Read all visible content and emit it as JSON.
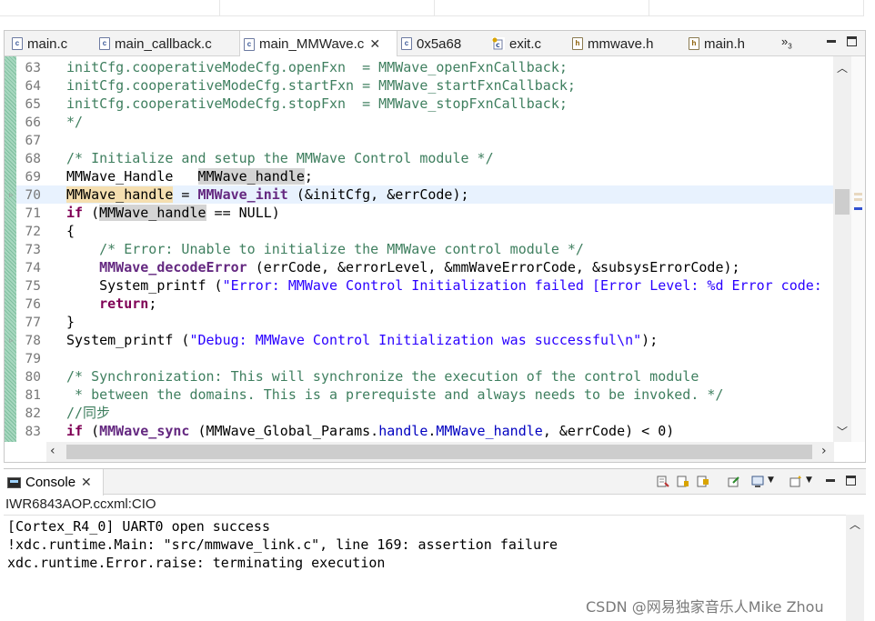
{
  "tabs": [
    {
      "label": "main.c",
      "icon": "c-file-icon",
      "active": false
    },
    {
      "label": "main_callback.c",
      "icon": "c-file-icon",
      "active": false
    },
    {
      "label": "main_MMWave.c",
      "icon": "c-file-icon",
      "active": true
    },
    {
      "label": "0x5a68",
      "icon": "disassembly-icon",
      "active": false
    },
    {
      "label": "exit.c",
      "icon": "c-file-icon",
      "active": false
    },
    {
      "label": "mmwave.h",
      "icon": "h-file-icon",
      "active": false
    },
    {
      "label": "main.h",
      "icon": "h-file-icon",
      "active": false
    }
  ],
  "tab_overflow": {
    "glyph": "»",
    "count": "3"
  },
  "code_lines": [
    {
      "n": "63"
    },
    {
      "n": "64"
    },
    {
      "n": "65"
    },
    {
      "n": "66"
    },
    {
      "n": "67"
    },
    {
      "n": "68"
    },
    {
      "n": "69"
    },
    {
      "n": "70"
    },
    {
      "n": "71"
    },
    {
      "n": "72"
    },
    {
      "n": "73"
    },
    {
      "n": "74"
    },
    {
      "n": "75"
    },
    {
      "n": "76"
    },
    {
      "n": "77"
    },
    {
      "n": "78"
    },
    {
      "n": "79"
    },
    {
      "n": "80"
    },
    {
      "n": "81"
    },
    {
      "n": "82"
    },
    {
      "n": "83"
    }
  ],
  "code": {
    "l63": [
      "initCfg.cooperativeModeCfg.openFxn  = MMWave_openFxnCallback;"
    ],
    "l64": [
      "initCfg.cooperativeModeCfg.startFxn = MMWave_startFxnCallback;"
    ],
    "l65": [
      "initCfg.cooperativeModeCfg.stopFxn  = MMWave_stopFxnCallback;"
    ],
    "l66": [
      "*/"
    ],
    "l68": [
      "/* Initialize and setup the MMWave Control module */"
    ],
    "l69": [
      "MMWave_Handle   ",
      "MMWave_handle",
      ";"
    ],
    "l70": [
      "MMWave_handle",
      " = ",
      "MMWave_init",
      " (&initCfg, &errCode);"
    ],
    "l71": [
      "if",
      " (",
      "MMWave_handle",
      " == NULL)"
    ],
    "l72": [
      "{"
    ],
    "l73": [
      "    ",
      "/* Error: Unable to initialize the MMWave control module */"
    ],
    "l74": [
      "    ",
      "MMWave_decodeError",
      " (errCode, &errorLevel, &mmWaveErrorCode, &subsysErrorCode);"
    ],
    "l75": [
      "    System_printf (",
      "\"Error: MMWave Control Initialization failed [Error Level: %d Error code:"
    ],
    "l76": [
      "    ",
      "return",
      ";"
    ],
    "l77": [
      "}"
    ],
    "l78": [
      "System_printf (",
      "\"Debug: MMWave Control Initialization was successful\\n\"",
      ");"
    ],
    "l80": [
      "/* Synchronization: This will synchronize the execution of the control module"
    ],
    "l81": [
      " * between the domains. This is a prerequiste and always needs to be invoked. */"
    ],
    "l82": [
      "//同步"
    ],
    "l83": [
      "if",
      " (",
      "MMWave_sync",
      " (MMWave_Global_Params.",
      "handle",
      ".",
      "MMWave_handle",
      ", &errCode) < 0)"
    ]
  },
  "console": {
    "tab_label": "Console",
    "title": "IWR6843AOP.ccxml:CIO",
    "lines": [
      "[Cortex_R4_0] UART0 open success",
      "!xdc.runtime.Main: \"src/mmwave_link.c\", line 169: assertion failure",
      "xdc.runtime.Error.raise: terminating execution"
    ]
  },
  "watermark": "CSDN @网易独家音乐人Mike Zhou",
  "colors": {
    "comment": "#3f7f5f",
    "keyword": "#7f0055",
    "function": "#642880",
    "field": "#0000c0",
    "string": "#2a00ff",
    "current_line": "#e8f2fe",
    "occurrence": "#d4d4d4",
    "write_occurrence": "#f5dfb0"
  }
}
